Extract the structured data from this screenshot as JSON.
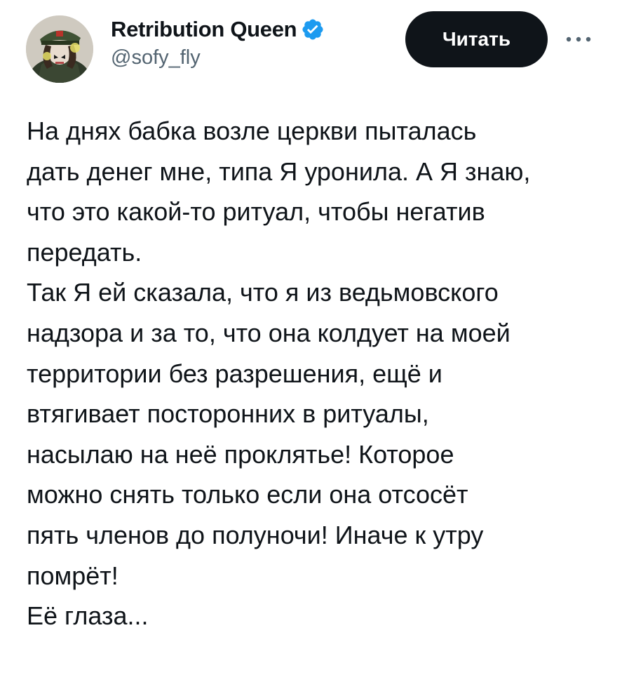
{
  "author": {
    "display_name": "Retribution Queen",
    "handle": "@sofy_fly",
    "verified": true,
    "avatar_icon": "avatar-image"
  },
  "actions": {
    "follow_label": "Читать",
    "more_icon": "more-horizontal-icon"
  },
  "colors": {
    "text": "#0f1419",
    "secondary_text": "#536471",
    "verified_blue": "#1d9bf0",
    "button_bg": "#0f1419",
    "button_text": "#ffffff"
  },
  "post": {
    "paragraphs": [
      {
        "lines": [
          "На днях бабка возле церкви пыталась",
          "дать денег мне, типа Я уронила. А Я знаю,",
          "что это какой-то ритуал, чтобы негатив",
          "передать."
        ]
      },
      {
        "lines": [
          "Так Я ей сказала, что я из ведьмовского",
          "надзора и за то, что она колдует на моей",
          "территории без разрешения, ещё и",
          "втягивает посторонних в ритуалы,",
          "насылаю на неё проклятье! Которое",
          "можно снять только если она отсосёт",
          "пять членов до полуночи! Иначе к утру",
          "помрёт!"
        ]
      },
      {
        "lines": [
          "Её глаза..."
        ]
      }
    ]
  }
}
